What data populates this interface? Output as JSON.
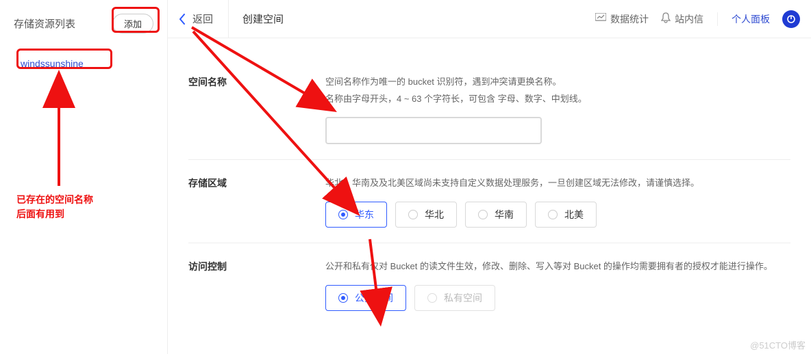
{
  "sidebar": {
    "title": "存储资源列表",
    "add_label": "添加",
    "items": [
      {
        "label": "windssunshine"
      }
    ]
  },
  "header": {
    "back_label": "返回",
    "page_title": "创建空间",
    "actions": {
      "stats_label": "数据统计",
      "messages_label": "站内信",
      "profile_label": "个人面板"
    }
  },
  "form": {
    "name": {
      "label": "空间名称",
      "hint_line1": "空间名称作为唯一的 bucket 识别符，遇到冲突请更换名称。",
      "hint_line2": "名称由字母开头，4 ~ 63 个字符长，可包含 字母、数字、中划线。",
      "value": ""
    },
    "region": {
      "label": "存储区域",
      "hint": "华北、华南及及北美区域尚未支持自定义数据处理服务，一旦创建区域无法修改，请谨慎选择。",
      "options": [
        {
          "label": "华东",
          "selected": true,
          "disabled": false
        },
        {
          "label": "华北",
          "selected": false,
          "disabled": false
        },
        {
          "label": "华南",
          "selected": false,
          "disabled": false
        },
        {
          "label": "北美",
          "selected": false,
          "disabled": false
        }
      ]
    },
    "access": {
      "label": "访问控制",
      "hint": "公开和私有仅对 Bucket 的读文件生效，修改、删除、写入等对 Bucket 的操作均需要拥有者的授权才能进行操作。",
      "options": [
        {
          "label": "公开空间",
          "selected": true,
          "disabled": false
        },
        {
          "label": "私有空间",
          "selected": false,
          "disabled": true
        }
      ]
    }
  },
  "annotation": {
    "note_line1": "已存在的空间名称",
    "note_line2": "后面有用到"
  },
  "watermark": "@51CTO博客"
}
